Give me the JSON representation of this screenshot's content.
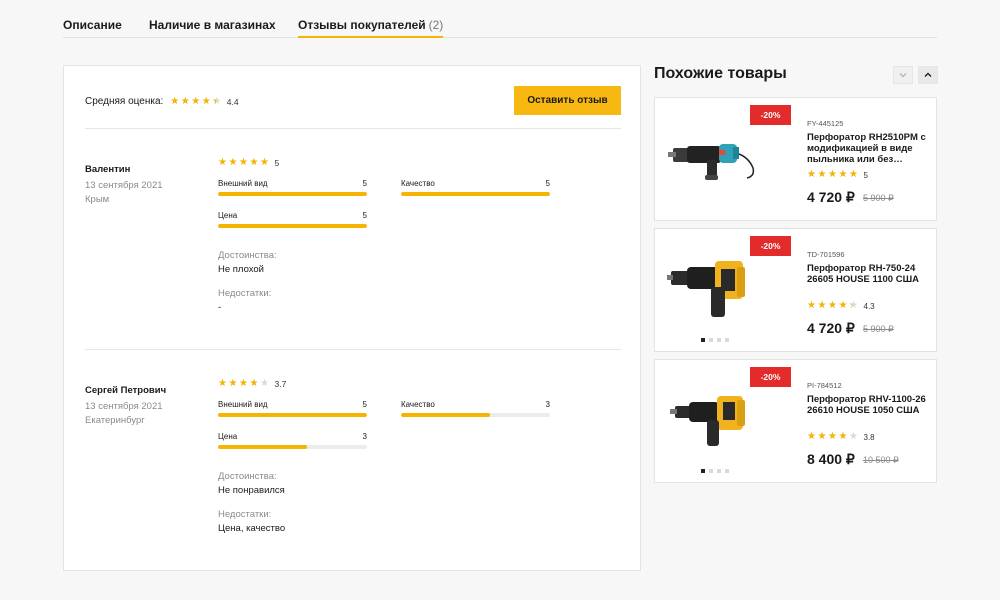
{
  "tabs": [
    {
      "label": "Описание"
    },
    {
      "label": "Наличие в магазинах"
    },
    {
      "label": "Отзывы покупателей",
      "count": "(2)"
    }
  ],
  "reviews_block": {
    "average_label": "Средняя оценка:",
    "average_value": "4.4",
    "average_rating": 4.4,
    "leave_review_button": "Оставить отзыв",
    "reviews": [
      {
        "name": "Валентин",
        "date": "13 сентября 2021",
        "city": "Крым",
        "rating": 5,
        "rating_text": "5",
        "metrics": [
          {
            "label": "Внешний вид",
            "value": "5",
            "level": 5
          },
          {
            "label": "Качество",
            "value": "5",
            "level": 5
          },
          {
            "label": "Цена",
            "value": "5",
            "level": 5
          }
        ],
        "pros_label": "Достоинства:",
        "pros": "Не плохой",
        "cons_label": "Недостатки:",
        "cons": "-"
      },
      {
        "name": "Сергей Петрович",
        "date": "13 сентября 2021",
        "city": "Екатеринбург",
        "rating": 3.7,
        "rating_text": "3.7",
        "metrics": [
          {
            "label": "Внешний вид",
            "value": "5",
            "level": 5
          },
          {
            "label": "Качество",
            "value": "3",
            "level": 3
          },
          {
            "label": "Цена",
            "value": "3",
            "level": 3
          }
        ],
        "pros_label": "Достоинства:",
        "pros": "Не понравился",
        "cons_label": "Недостатки:",
        "cons": "Цена, качество"
      }
    ]
  },
  "similar": {
    "title": "Похожие товары",
    "nav_down_icon": "chevron-down-icon",
    "nav_up_icon": "chevron-up-icon",
    "products": [
      {
        "discount": "-20%",
        "sku": "FY-445125",
        "name": "Перфоратор RH2510PM с модификацией в виде пыльника или без…",
        "rating": 5,
        "rating_text": "5",
        "price": "4 720 ₽",
        "old_price": "5 900 ₽",
        "image": "blue-rotary-hammer",
        "dots": 0,
        "active_dot": 0
      },
      {
        "discount": "-20%",
        "sku": "TD-701596",
        "name": "Перфоратор RH-750-24 26605 HOUSE 1100 США",
        "rating": 4.3,
        "rating_text": "4.3",
        "price": "4 720 ₽",
        "old_price": "5 900 ₽",
        "image": "yellow-rotary-hammer",
        "dots": 4,
        "active_dot": 0
      },
      {
        "discount": "-20%",
        "sku": "PI-784512",
        "name": "Перфоратор RHV-1100-26 26610 HOUSE 1050 США",
        "rating": 3.8,
        "rating_text": "3.8",
        "price": "8 400 ₽",
        "old_price": "10 500 ₽",
        "image": "yellow-rotary-hammer",
        "dots": 4,
        "active_dot": 0
      }
    ]
  },
  "colors": {
    "accent": "#f8b812",
    "discount": "#e32b2b",
    "star": "#f5b400"
  }
}
